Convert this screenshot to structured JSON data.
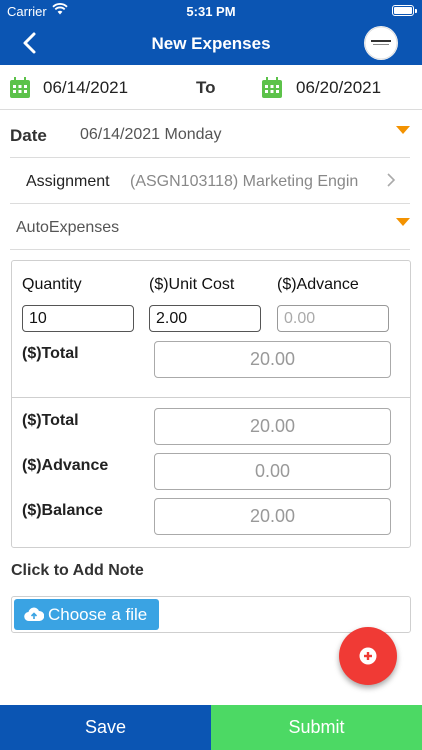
{
  "status_bar": {
    "carrier": "Carrier",
    "time": "5:31 PM"
  },
  "nav": {
    "title": "New Expenses"
  },
  "date_range": {
    "from": "06/14/2021",
    "to_label": "To",
    "to": "06/20/2021"
  },
  "date_field": {
    "label": "Date",
    "value": "06/14/2021 Monday"
  },
  "assignment": {
    "label": "Assignment",
    "value": "(ASGN103118) Marketing Engin"
  },
  "expense_type": {
    "value": "AutoExpenses"
  },
  "line": {
    "quantity_label": "Quantity",
    "quantity_value": "10",
    "unit_cost_label": "($)Unit Cost",
    "unit_cost_value": "2.00",
    "advance_label": "($)Advance",
    "advance_placeholder": "0.00",
    "total_label": "($)Total",
    "total_value": "20.00"
  },
  "summary": {
    "total_label": "($)Total",
    "total_value": "20.00",
    "advance_label": "($)Advance",
    "advance_value": "0.00",
    "balance_label": "($)Balance",
    "balance_value": "20.00"
  },
  "note": {
    "label": "Click to Add Note",
    "file_button": "Choose a file"
  },
  "actions": {
    "save": "Save",
    "submit": "Submit"
  },
  "colors": {
    "primary": "#0b55b3",
    "accent_orange": "#f39200",
    "submit_green": "#4cd964",
    "fab_red": "#f03a35",
    "file_blue": "#3aa3e3",
    "calendar_green": "#5cc24a"
  },
  "icons": {
    "status": [
      "wifi-icon",
      "battery-icon"
    ],
    "nav": [
      "back-chevron-icon",
      "company-logo"
    ],
    "fields": [
      "calendar-icon",
      "dropdown-triangle-icon",
      "chevron-right-icon",
      "cloud-upload-icon",
      "plus-icon"
    ]
  }
}
